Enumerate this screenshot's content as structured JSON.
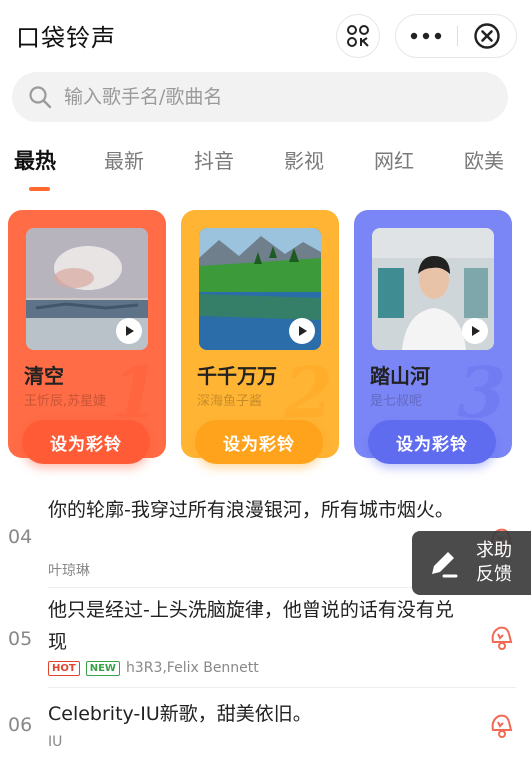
{
  "header": {
    "app_title": "口袋铃声"
  },
  "search": {
    "placeholder": "输入歌手名/歌曲名"
  },
  "tabs": [
    {
      "label": "最热",
      "active": true
    },
    {
      "label": "最新"
    },
    {
      "label": "抖音"
    },
    {
      "label": "影视"
    },
    {
      "label": "网红"
    },
    {
      "label": "欧美"
    }
  ],
  "cards": [
    {
      "rank": "1",
      "title": "清空",
      "artist": "王忻辰,苏星婕",
      "cta": "设为彩铃",
      "color": "#ff6c45",
      "cta_color": "#ff5b36"
    },
    {
      "rank": "2",
      "title": "千千万万",
      "artist": "深海鱼子酱",
      "cta": "设为彩铃",
      "color": "#ffb434",
      "cta_color": "#ffa21c"
    },
    {
      "rank": "3",
      "title": "踏山河",
      "artist": "是七叔呢",
      "cta": "设为彩铃",
      "color": "#7b86f6",
      "cta_color": "#5f6cf0"
    }
  ],
  "songs": [
    {
      "num": "04",
      "name": "你的轮廓-我穿过所有浪漫银河，所有城市烟火。",
      "artist": "叶琼琳",
      "badges": []
    },
    {
      "num": "05",
      "name": "他只是经过-上头洗脑旋律，他曾说的话有没有兑现",
      "artist": "h3R3,Felix Bennett",
      "badges": [
        "HOT",
        "NEW"
      ]
    },
    {
      "num": "06",
      "name": "Celebrity-IU新歌，甜美依旧。",
      "artist": "IU",
      "badges": []
    }
  ],
  "feedback": {
    "line1": "求助",
    "line2": "反馈"
  },
  "colors": {
    "accent": "#ff6a2c",
    "bell": "#f06a55"
  }
}
